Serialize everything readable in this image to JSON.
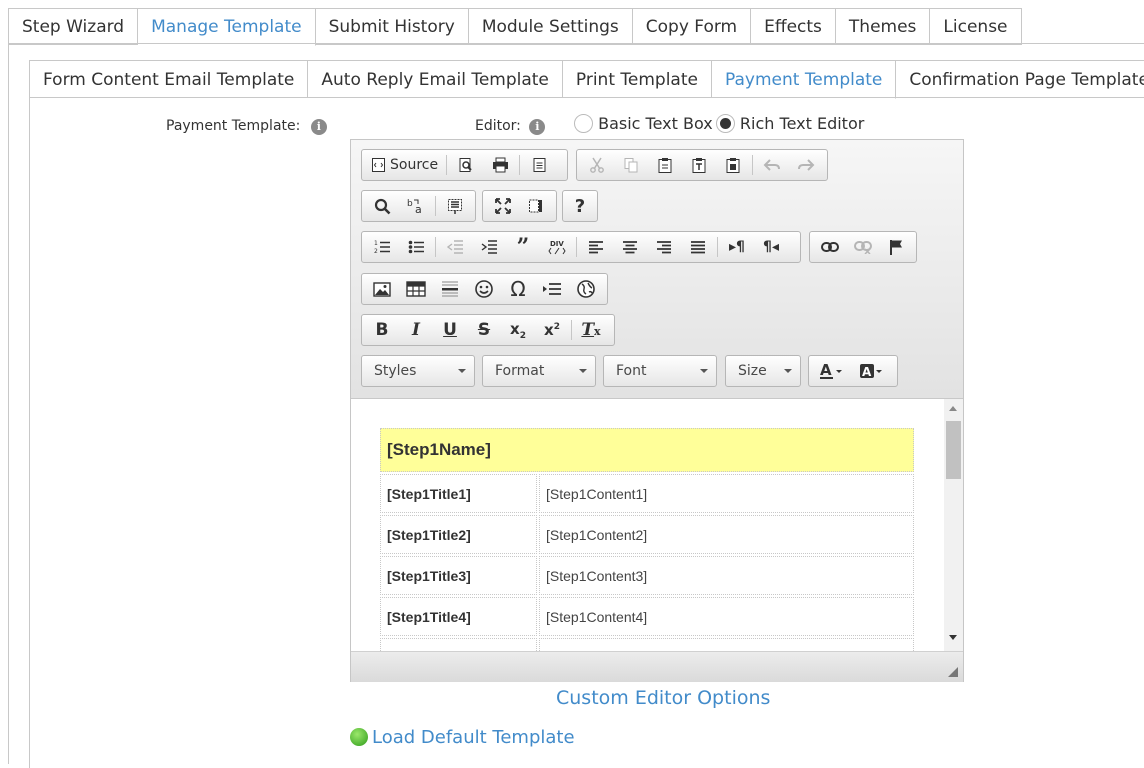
{
  "main_tabs": [
    "Step Wizard",
    "Manage Template",
    "Submit History",
    "Module Settings",
    "Copy Form",
    "Effects",
    "Themes",
    "License"
  ],
  "main_tabs_active": "Manage Template",
  "template_tabs": [
    "Form Content Email Template",
    "Auto Reply Email Template",
    "Print Template",
    "Payment Template",
    "Confirmation Page Template"
  ],
  "template_tabs_active": "Payment Template",
  "form": {
    "payment_template_label": "Payment Template:",
    "editor_label": "Editor:",
    "editor_options": [
      {
        "label": "Basic Text Box",
        "selected": false
      },
      {
        "label": "Rich Text Editor",
        "selected": true
      }
    ]
  },
  "toolbar": {
    "source_label": "Source",
    "help_label": "?",
    "dropdowns": {
      "styles": "Styles",
      "format": "Format",
      "font": "Font",
      "size": "Size"
    }
  },
  "content_table": {
    "header": "[Step1Name]",
    "rows": [
      {
        "title": "[Step1Title1]",
        "content": "[Step1Content1]"
      },
      {
        "title": "[Step1Title2]",
        "content": "[Step1Content2]"
      },
      {
        "title": "[Step1Title3]",
        "content": "[Step1Content3]"
      },
      {
        "title": "[Step1Title4]",
        "content": "[Step1Content4]"
      },
      {
        "title": "",
        "content": ""
      }
    ]
  },
  "links": {
    "custom_editor": "Custom Editor Options",
    "load_default": "Load Default Template"
  },
  "colors": {
    "accent": "#428bca",
    "header_fill": "#ffff99"
  }
}
